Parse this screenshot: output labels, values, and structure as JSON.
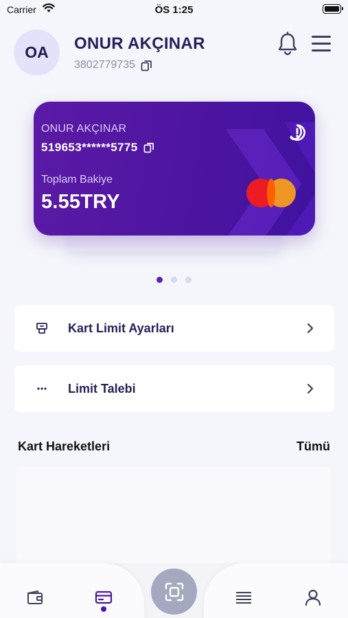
{
  "status_bar": {
    "carrier": "Carrier",
    "time": "ÖS 1:25"
  },
  "profile": {
    "initials": "OA",
    "name": "ONUR AKÇINAR",
    "customer_id": "3802779735"
  },
  "card": {
    "holder": "ONUR AKÇINAR",
    "masked_number": "519653******5775",
    "balance_label": "Toplam Bakiye",
    "balance_value": "5.55TRY",
    "network": "mastercard",
    "gradient_start": "#5b1aa6",
    "gradient_end": "#3f12a0"
  },
  "pager": {
    "count": 3,
    "active_index": 0
  },
  "menu": {
    "limit_settings_label": "Kart Limit Ayarları",
    "limit_request_label": "Limit Talebi"
  },
  "transactions": {
    "title": "Kart Hareketleri",
    "see_all": "Tümü"
  },
  "bottom_nav": {
    "items": [
      "wallet-icon",
      "card-icon",
      "scan-icon",
      "list-icon",
      "profile-icon"
    ],
    "active": "card-icon"
  },
  "colors": {
    "accent": "#5b21b6",
    "text_primary": "#24215a",
    "background": "#f5f6fb"
  }
}
